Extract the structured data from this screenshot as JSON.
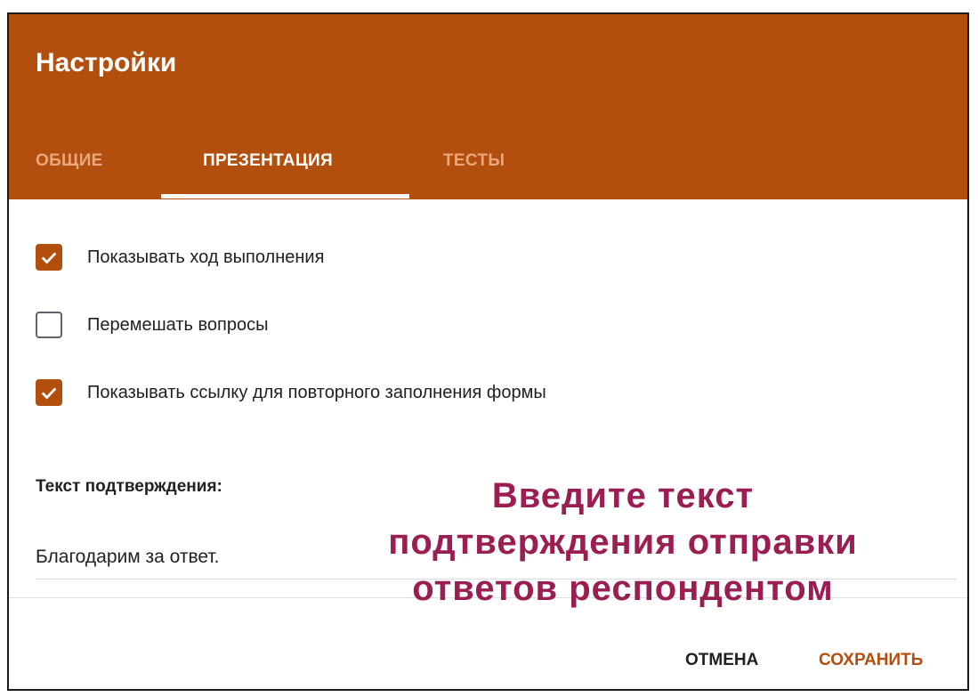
{
  "dialog": {
    "title": "Настройки"
  },
  "tabs": [
    {
      "label": "ОБЩИЕ",
      "active": false
    },
    {
      "label": "ПРЕЗЕНТАЦИЯ",
      "active": true
    },
    {
      "label": "ТЕСТЫ",
      "active": false
    }
  ],
  "options": [
    {
      "label": "Показывать ход выполнения",
      "checked": true
    },
    {
      "label": "Перемешать вопросы",
      "checked": false
    },
    {
      "label": "Показывать ссылку для повторного заполнения формы",
      "checked": true
    }
  ],
  "confirmation": {
    "heading": "Текст подтверждения:",
    "value": "Благодарим за ответ."
  },
  "annotation": {
    "line1": "Введите текст",
    "line2": "подтверждения отправки",
    "line3": "ответов респондентом"
  },
  "actions": {
    "cancel_label": "ОТМЕНА",
    "save_label": "СОХРАНИТЬ"
  },
  "colors": {
    "accent": "#b24f0f",
    "annotation": "#9b1e52",
    "tab_inactive": "#e9a77b"
  },
  "icons": {
    "checkbox_checked": "check-icon"
  }
}
